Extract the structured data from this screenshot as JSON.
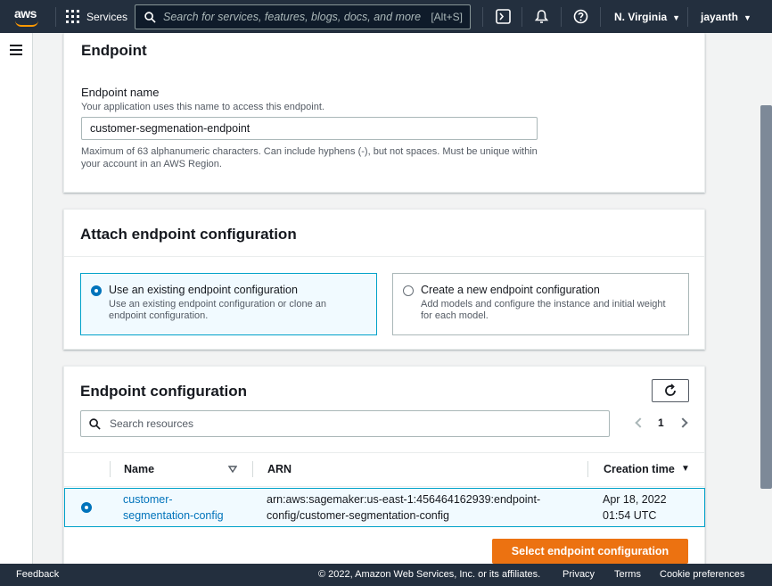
{
  "topnav": {
    "logo_text": "aws",
    "services_label": "Services",
    "search_placeholder": "Search for services, features, blogs, docs, and more",
    "search_shortcut": "[Alt+S]",
    "region": "N. Virginia",
    "user": "jayanth",
    "icons": [
      "cloudshell-icon",
      "bell-icon",
      "help-icon"
    ]
  },
  "endpoint_card": {
    "title": "Endpoint",
    "name_label": "Endpoint name",
    "name_description": "Your application uses this name to access this endpoint.",
    "name_value": "customer-segmenation-endpoint",
    "name_constraint": "Maximum of 63 alphanumeric characters. Can include hyphens (-), but not spaces. Must be unique within your account in an AWS Region."
  },
  "attach_card": {
    "title": "Attach endpoint configuration",
    "options": [
      {
        "label": "Use an existing endpoint configuration",
        "description": "Use an existing endpoint configuration or clone an endpoint configuration.",
        "selected": true
      },
      {
        "label": "Create a new endpoint configuration",
        "description": "Add models and configure the instance and initial weight for each model.",
        "selected": false
      }
    ]
  },
  "config_card": {
    "title": "Endpoint configuration",
    "search_placeholder": "Search resources",
    "page": "1",
    "columns": {
      "name": "Name",
      "arn": "ARN",
      "creation_time": "Creation time"
    },
    "rows": [
      {
        "name_line1": "customer-",
        "name_line2": "segmentation-config",
        "arn_line1": "arn:aws:sagemaker:us-east-1:456464162939:endpoint-",
        "arn_line2": "config/customer-segmentation-config",
        "time_line1": "Apr 18, 2022",
        "time_line2": "01:54 UTC",
        "selected": true
      }
    ],
    "select_button": "Select endpoint configuration"
  },
  "footer": {
    "feedback": "Feedback",
    "copyright": "© 2022, Amazon Web Services, Inc. or its affiliates.",
    "privacy": "Privacy",
    "terms": "Terms",
    "cookies": "Cookie preferences"
  },
  "colors": {
    "nav_bg": "#232f3e",
    "accent_orange": "#ec7211",
    "link_blue": "#0073bb",
    "selected_bg": "#f1faff"
  }
}
